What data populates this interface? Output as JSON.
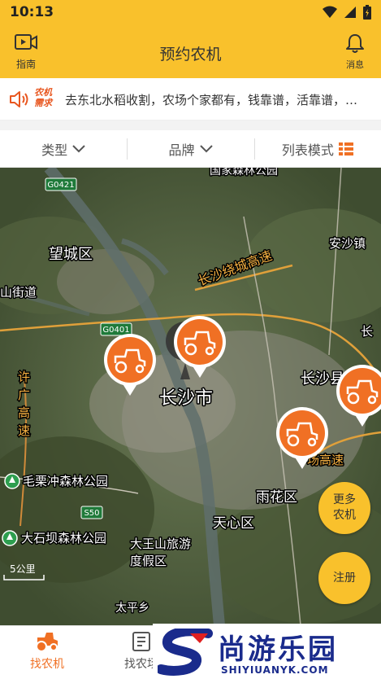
{
  "status": {
    "time": "10:13"
  },
  "appbar": {
    "guide_label": "指南",
    "title": "预约农机",
    "message_label": "消息"
  },
  "notice": {
    "badge_line1": "农机",
    "badge_line2": "需求",
    "text": "去东北水稻收割，农场个家都有，钱靠谱，活靠谱，…"
  },
  "filters": {
    "type": "类型",
    "brand": "品牌",
    "list_mode": "列表模式"
  },
  "map": {
    "labels": {
      "park_top": "国家森林公园",
      "road_g0421": "G0421",
      "wangcheng": "望城区",
      "anshazhen": "安沙镇",
      "shanjiedao": "山街道",
      "ring_expressway": "长沙绕城高速",
      "road_g0401": "G0401",
      "chang": "长",
      "changsha_county": "长沙县",
      "xuguang_expressway": "许广高速",
      "changsha_city": "长沙市",
      "expressway_right": "场高速",
      "maolichong": "毛栗冲森林公园",
      "road_s50": "S50",
      "yuhua": "雨花区",
      "tianxin": "天心区",
      "dashiba": "大石坝森林公园",
      "dawangshan": "大王山旅游",
      "dujiaqu": "度假区",
      "taiping": "太平乡",
      "scale": "5公里"
    },
    "more_button": "更多\n农机",
    "register_button": "注册"
  },
  "bottom_nav": {
    "find_machine": "找农机",
    "find_other": "找农场"
  },
  "watermark": {
    "brand": "尚游乐园",
    "url": "SHIYIUANYK.COM"
  },
  "colors": {
    "accent": "#f9c12c",
    "marker": "#f07024"
  }
}
